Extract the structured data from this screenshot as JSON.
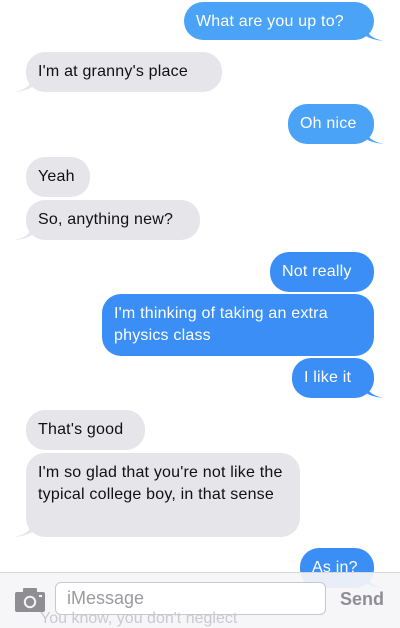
{
  "thread": {
    "messages": [
      {
        "from": "me",
        "text": "What are you up to?"
      },
      {
        "from": "them",
        "text": "I'm at granny's place"
      },
      {
        "from": "me",
        "text": "Oh nice"
      },
      {
        "from": "them",
        "text": "Yeah"
      },
      {
        "from": "them",
        "text": "So, anything new?"
      },
      {
        "from": "me",
        "text": "Not really"
      },
      {
        "from": "me",
        "text": "I'm thinking of taking an extra physics class"
      },
      {
        "from": "me",
        "text": "I like it"
      },
      {
        "from": "them",
        "text": "That's good"
      },
      {
        "from": "them",
        "text": "I'm so glad that you're not like the typical college boy, in that sense"
      },
      {
        "from": "me",
        "text": "As in?"
      }
    ],
    "partial_below": "You know, you don't neglect"
  },
  "composer": {
    "placeholder": "iMessage",
    "send_label": "Send",
    "camera_icon": "camera-icon"
  },
  "colors": {
    "outgoing": "#4aa3f7",
    "outgoing_dark": "#3a8ef5",
    "incoming": "#e5e5ea",
    "send_disabled": "#8e8e93"
  }
}
